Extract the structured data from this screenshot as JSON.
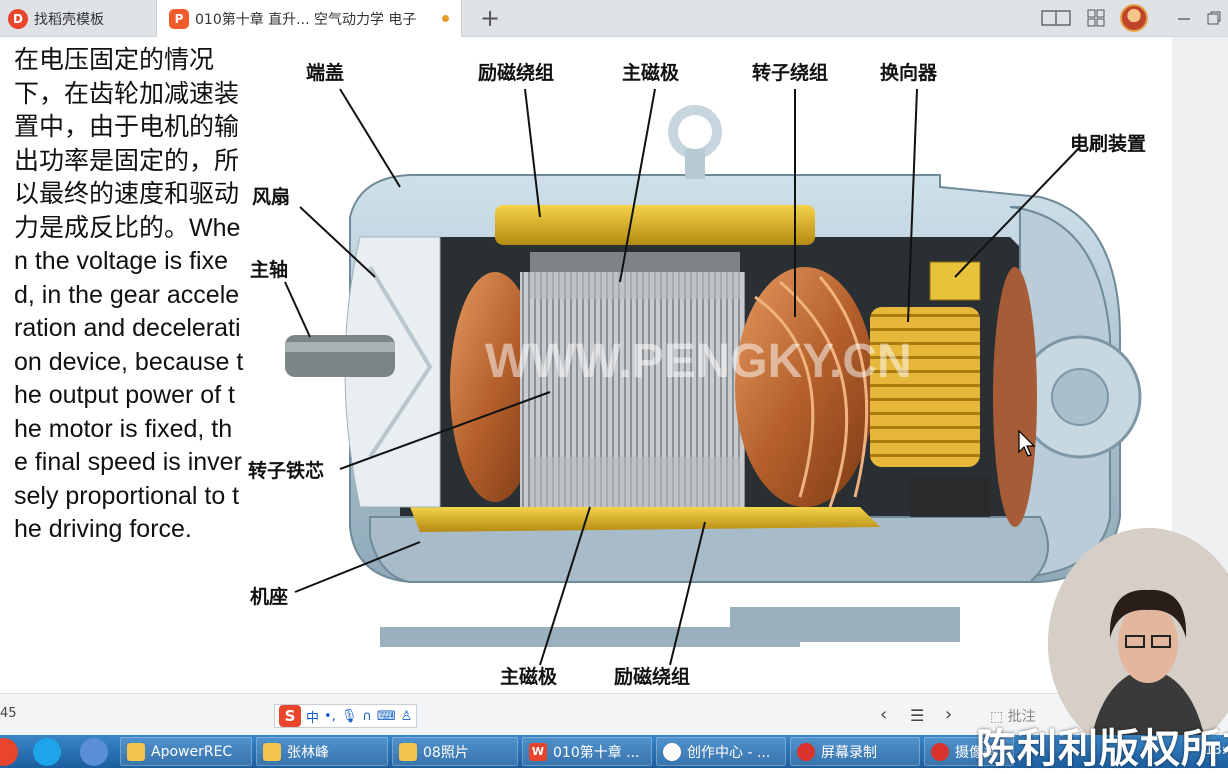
{
  "tabs": [
    {
      "label": "找稻壳模板",
      "icon": "docer-icon"
    },
    {
      "label": "010第十章 直升... 空气动力学 电子",
      "icon": "wps-presentation-icon"
    }
  ],
  "new_tab": "+",
  "slide": {
    "text": "在电压固定的情况下，在齿轮加减速装置中，由于电机的输出功率是固定的，所以最终的速度和驱动力是成反比的。When the voltage is fixed, in the gear acceleration and deceleration device, because the output power of the motor is fixed, the final speed is inversely proportional to the driving force.",
    "diagram_watermark": "WWW.PENGKY.CN",
    "labels": {
      "end_cover": "端盖",
      "field_winding_top": "励磁绕组",
      "main_pole_top": "主磁极",
      "rotor_winding": "转子绕组",
      "commutator": "换向器",
      "brush": "电刷装置",
      "fan": "风扇",
      "shaft": "主轴",
      "rotor_core": "转子铁芯",
      "frame": "机座",
      "main_pole_bottom": "主磁极",
      "field_winding_bottom": "励磁绕组"
    }
  },
  "statusbar": {
    "page": "45",
    "ime_label": "中",
    "annotate": "批注"
  },
  "taskbar": {
    "items": [
      {
        "label": "ApowerREC",
        "icon": "folder-icon"
      },
      {
        "label": "张林峰",
        "icon": "folder-icon"
      },
      {
        "label": "08照片",
        "icon": "folder-icon"
      },
      {
        "label": "010第十章 ...",
        "icon": "wps-icon"
      },
      {
        "label": "创作中心 - ...",
        "icon": "browser-icon"
      },
      {
        "label": "屏幕录制",
        "icon": "record-icon"
      },
      {
        "label": "摄像头",
        "icon": "record-icon"
      }
    ],
    "clock": "13:",
    "watermark": "陈利利版权所有"
  },
  "colors": {
    "tabbar": "#dfe3e8",
    "taskbar": "#1f6fb5",
    "accent": "#e8452c"
  }
}
